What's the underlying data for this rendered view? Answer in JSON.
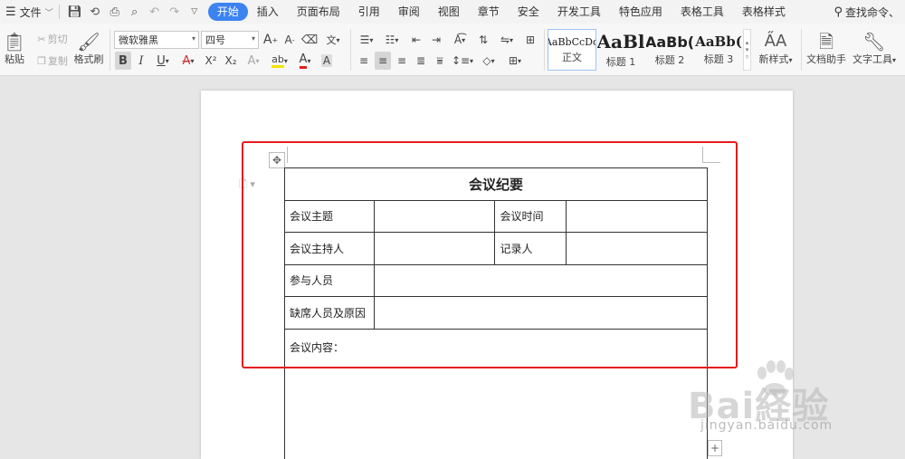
{
  "menubar": {
    "file_label": "文件",
    "tabs": [
      {
        "label": "开始",
        "active": true
      },
      {
        "label": "插入"
      },
      {
        "label": "页面布局"
      },
      {
        "label": "引用"
      },
      {
        "label": "审阅"
      },
      {
        "label": "视图"
      },
      {
        "label": "章节"
      },
      {
        "label": "安全"
      },
      {
        "label": "开发工具"
      },
      {
        "label": "特色应用"
      },
      {
        "label": "表格工具"
      },
      {
        "label": "表格样式"
      }
    ],
    "find_command": "查找命令、",
    "accent_color": "#3c82f0"
  },
  "ribbon": {
    "paste_label": "粘贴",
    "cut_label": "剪切",
    "copy_label": "复制",
    "format_painter_label": "格式刷",
    "font_name": "微软雅黑",
    "font_size": "四号",
    "bold_label": "B",
    "italic_label": "I",
    "underline_label": "U",
    "strike_label": "A",
    "superscript_label": "X²",
    "subscript_label": "X₂",
    "styles": [
      {
        "preview": "AaBbCcDd",
        "label": "正文"
      },
      {
        "preview": "AaBl",
        "label": "标题 1"
      },
      {
        "preview": "AaBb(",
        "label": "标题 2"
      },
      {
        "preview": "AaBb(",
        "label": "标题 3"
      }
    ],
    "new_style_label": "新样式",
    "doc_helper_label": "文档助手",
    "text_tools_label": "文字工具"
  },
  "document": {
    "table": {
      "title": "会议纪要",
      "topic_label": "会议主题",
      "time_label": "会议时间",
      "host_label": "会议主持人",
      "recorder_label": "记录人",
      "attendees_label": "参与人员",
      "absent_label": "缺席人员及原因",
      "content_label": "会议内容："
    },
    "highlight_color": "#e51c1c"
  },
  "watermark": {
    "brand": "Bai経验",
    "url": "jingyan.baidu.com"
  }
}
